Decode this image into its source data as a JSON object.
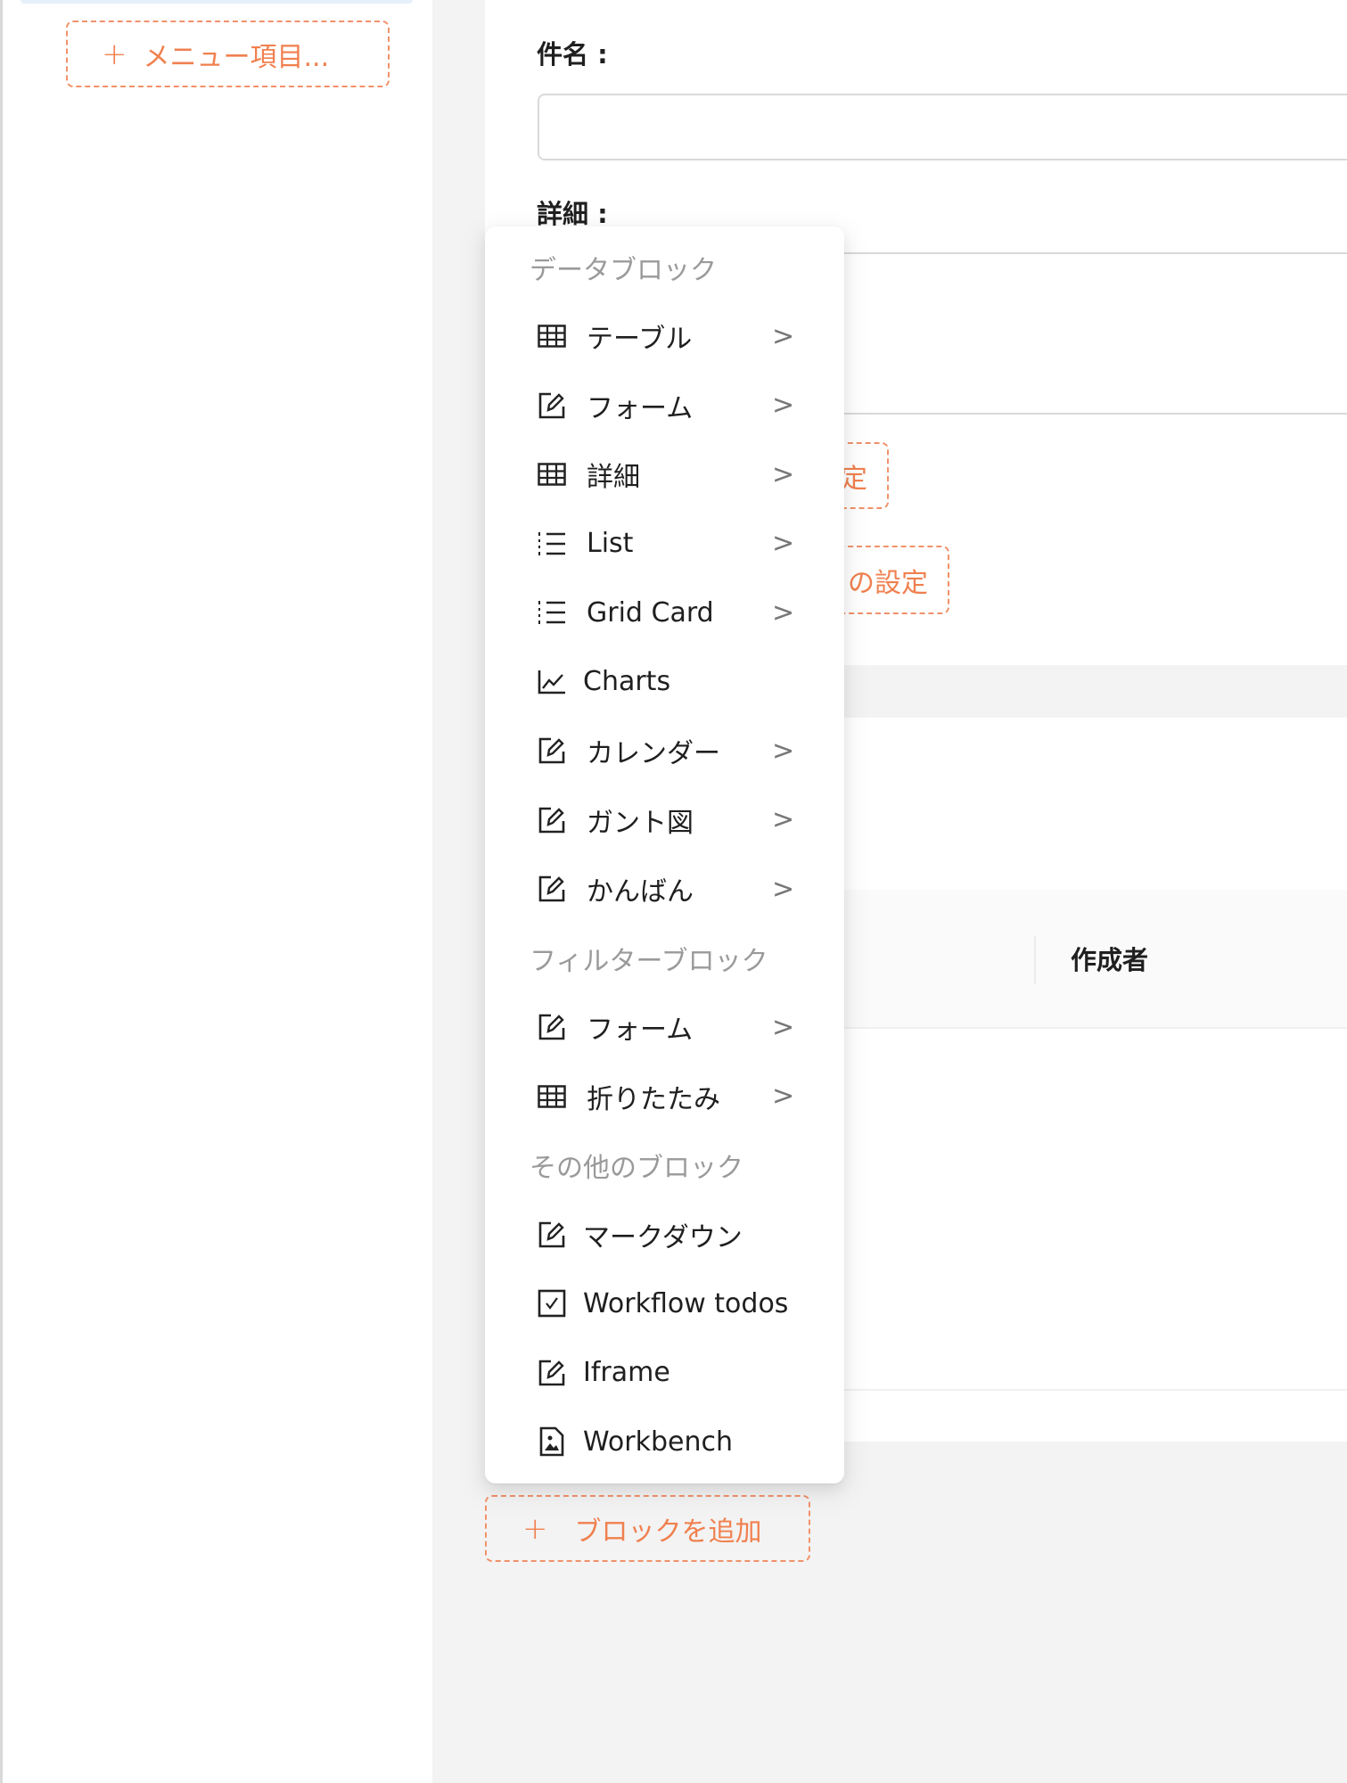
{
  "sidebar": {
    "add_menu_item": "メニュー項目..."
  },
  "form": {
    "subject_label": "件名 :",
    "detail_label": "詳細 :",
    "settings_btn_1": "定",
    "settings_btn_2": "の設定"
  },
  "table": {
    "column_creator": "作成者"
  },
  "add_block_label": "ブロックを追加",
  "accent_color": "#f0804f",
  "menu": {
    "rows": [
      {
        "type": "group",
        "label": "データブロック"
      },
      {
        "type": "item",
        "icon": "table-icon",
        "label": "テーブル",
        "submenu": true
      },
      {
        "type": "item",
        "icon": "form-icon",
        "label": "フォーム",
        "submenu": true
      },
      {
        "type": "item",
        "icon": "table-icon",
        "label": "詳細",
        "submenu": true
      },
      {
        "type": "item",
        "icon": "list-icon",
        "label": "List",
        "submenu": true
      },
      {
        "type": "item",
        "icon": "list-icon",
        "label": "Grid Card",
        "submenu": true
      },
      {
        "type": "item",
        "icon": "line-chart-icon",
        "label": "Charts",
        "submenu": false
      },
      {
        "type": "item",
        "icon": "form-icon",
        "label": "カレンダー",
        "submenu": true
      },
      {
        "type": "item",
        "icon": "form-icon",
        "label": "ガント図",
        "submenu": true
      },
      {
        "type": "item",
        "icon": "form-icon",
        "label": "かんばん",
        "submenu": true
      },
      {
        "type": "group",
        "label": "フィルターブロック"
      },
      {
        "type": "item",
        "icon": "form-icon",
        "label": "フォーム",
        "submenu": true
      },
      {
        "type": "item",
        "icon": "table-icon",
        "label": "折りたたみ",
        "submenu": true
      },
      {
        "type": "group",
        "label": "その他のブロック"
      },
      {
        "type": "item",
        "icon": "form-icon",
        "label": "マークダウン",
        "submenu": false
      },
      {
        "type": "item",
        "icon": "checkbox-icon",
        "label": "Workflow todos",
        "submenu": false
      },
      {
        "type": "item",
        "icon": "form-icon",
        "label": "Iframe",
        "submenu": false
      },
      {
        "type": "item",
        "icon": "file-image-icon",
        "label": "Workbench",
        "submenu": false
      }
    ]
  }
}
